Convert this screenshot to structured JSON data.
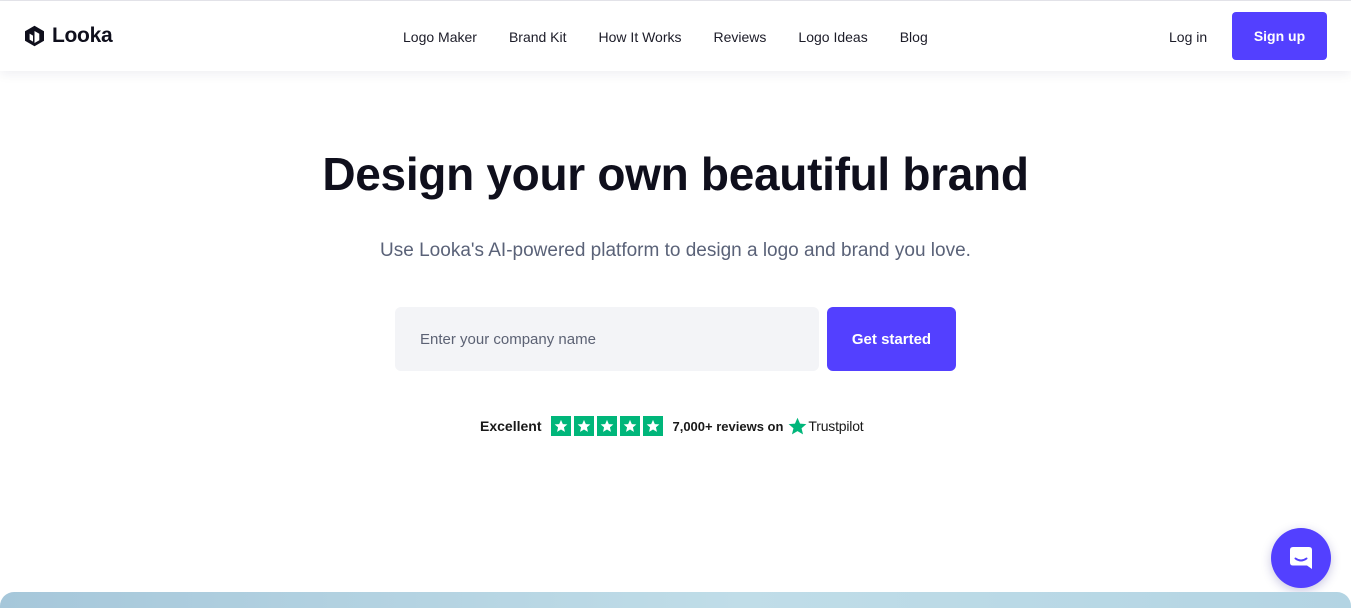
{
  "brand": {
    "name": "Looka",
    "accent": "#5340ff"
  },
  "nav": {
    "links": [
      "Logo Maker",
      "Brand Kit",
      "How It Works",
      "Reviews",
      "Logo Ideas",
      "Blog"
    ],
    "login_label": "Log in",
    "signup_label": "Sign up"
  },
  "hero": {
    "title": "Design your own beautiful brand",
    "subtitle": "Use Looka's AI-powered platform to design a logo and brand you love.",
    "input_placeholder": "Enter your company name",
    "input_value": "",
    "cta_label": "Get started"
  },
  "trustpilot": {
    "rating_label": "Excellent",
    "stars": 5,
    "star_color": "#00b67a",
    "reviews_text": "7,000+ reviews on",
    "brand": "Trustpilot"
  },
  "chat": {
    "icon": "chat-bubble-icon"
  }
}
